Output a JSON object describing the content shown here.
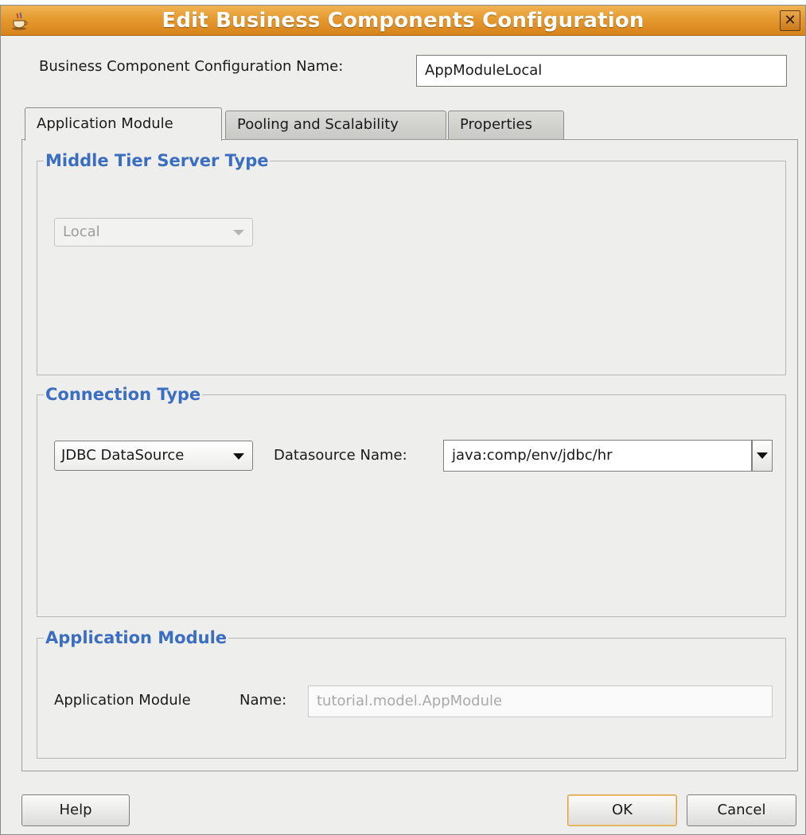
{
  "window": {
    "title": "Edit Business Components Configuration",
    "close_glyph": "✕",
    "app_icon": "java-cup-icon"
  },
  "config_name": {
    "label": "Business Component Configuration Name:",
    "value": "AppModuleLocal"
  },
  "tabs": [
    {
      "label": "Application Module",
      "active": true
    },
    {
      "label": "Pooling and Scalability",
      "active": false
    },
    {
      "label": "Properties",
      "active": false
    }
  ],
  "middle_tier": {
    "legend": "Middle Tier Server Type",
    "server_type": "Local"
  },
  "connection": {
    "legend": "Connection Type",
    "type": "JDBC DataSource",
    "datasource_label": "Datasource Name:",
    "datasource_value": "java:comp/env/jdbc/hr"
  },
  "app_module": {
    "legend": "Application Module",
    "label_left": "Application Module",
    "label_right": "Name:",
    "value": "tutorial.model.AppModule"
  },
  "buttons": {
    "help": "Help",
    "ok": "OK",
    "cancel": "Cancel"
  },
  "colors": {
    "titlebar": "#e59a2f",
    "legend": "#3b6ec1",
    "dialog_bg": "#eeeeec"
  }
}
